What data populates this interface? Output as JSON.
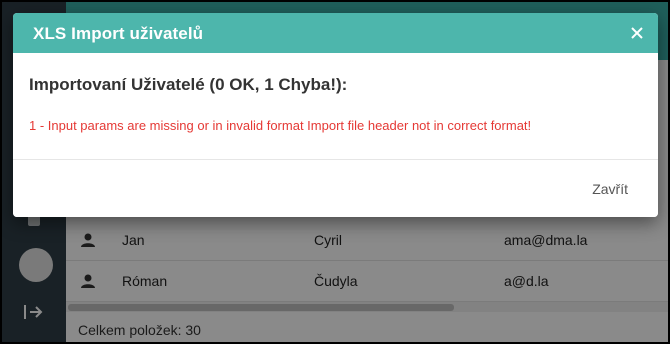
{
  "dialog": {
    "title": "XLS Import uživatelů",
    "summary": "Importovaní Uživatelé (0 OK, 1 Chyba!):",
    "errors": [
      "1 - Input params are missing or in invalid format Import file header not in correct format!"
    ],
    "close_button_label": "Zavřít",
    "close_icon": "close-icon",
    "header_color": "#4db6ac",
    "error_color": "#e53935"
  },
  "table": {
    "rows": [
      {
        "icon": "person-icon",
        "first_name": "Jan",
        "last_name": "Cyril",
        "email": "ama@dma.la"
      },
      {
        "icon": "person-icon",
        "first_name": "Róman",
        "last_name": "Čudyla",
        "email": "a@d.la"
      }
    ],
    "total_label": "Celkem položek: 30"
  },
  "sidebar": {
    "logout_icon": "logout-icon",
    "avatar_icon": "avatar"
  },
  "colors": {
    "sidebar_bg": "#2f3e47",
    "app_accent": "#3aafa9"
  }
}
